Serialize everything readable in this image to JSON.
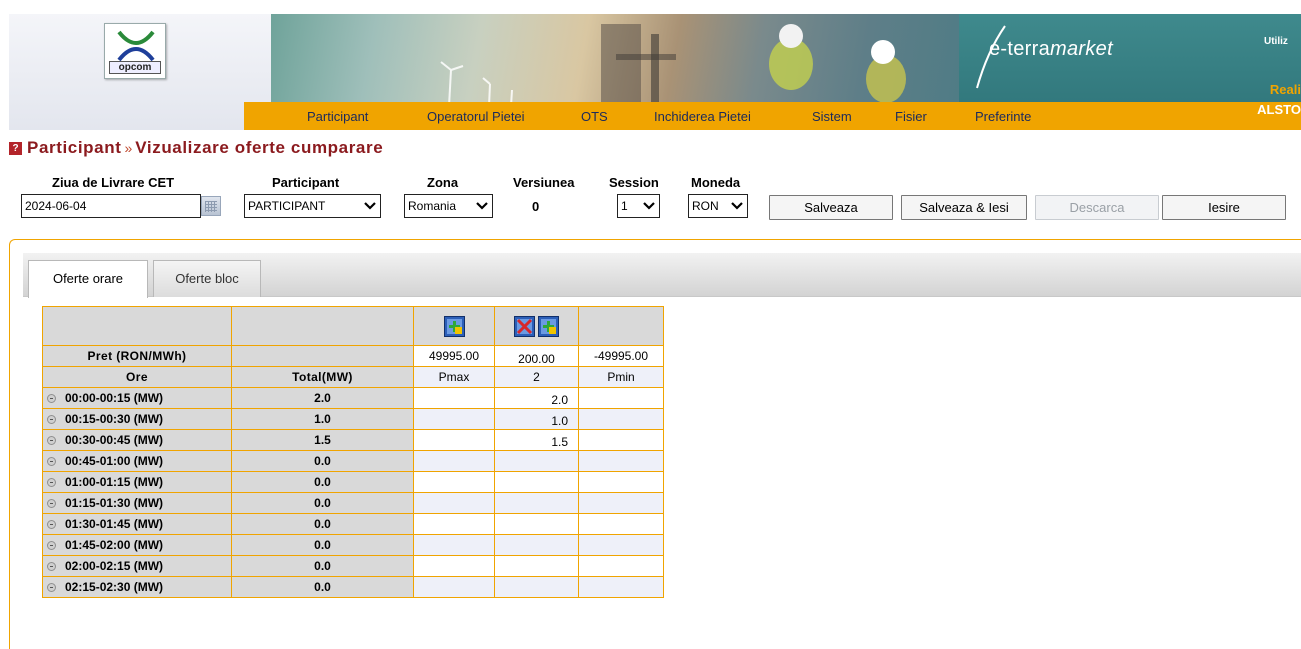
{
  "header": {
    "logo_text": "opcom",
    "brand_prefix": "e-terra",
    "brand_suffix": "market",
    "util_label": "Utiliz",
    "user_line_1": "Reali",
    "user_line_2": "ALSTO",
    "menu": [
      "Participant",
      "Operatorul Pietei",
      "OTS",
      "Inchiderea Pietei",
      "Sistem",
      "Fisier",
      "Preferinte"
    ]
  },
  "title": {
    "section": "Participant",
    "separator": "»",
    "page": "Vizualizare oferte cumparare"
  },
  "filters": {
    "date_label": "Ziua de Livrare CET",
    "date_value": "2024-06-04",
    "participant_label": "Participant",
    "participant_value": "PARTICIPANT",
    "zona_label": "Zona",
    "zona_value": "Romania",
    "versiunea_label": "Versiunea",
    "versiunea_value": "0",
    "session_label": "Session",
    "session_value": "1",
    "moneda_label": "Moneda",
    "moneda_value": "RON"
  },
  "buttons": {
    "save": "Salveaza",
    "save_exit": "Salveaza & Iesi",
    "download": "Descarca",
    "exit": "Iesire"
  },
  "tabs": [
    "Oferte orare",
    "Oferte bloc"
  ],
  "grid": {
    "price_label": "Pret (RON/MWh)",
    "hours_label": "Ore",
    "total_label": "Total(MW)",
    "prices": [
      "49995.00",
      "200.00",
      "-49995.00"
    ],
    "column_labels": [
      "Pmax",
      "2",
      "Pmin"
    ],
    "rows": [
      {
        "interval": "00:00-00:15 (MW)",
        "total": "2.0",
        "values": [
          "",
          "2.0",
          ""
        ]
      },
      {
        "interval": "00:15-00:30 (MW)",
        "total": "1.0",
        "values": [
          "",
          "1.0",
          ""
        ]
      },
      {
        "interval": "00:30-00:45 (MW)",
        "total": "1.5",
        "values": [
          "",
          "1.5",
          ""
        ]
      },
      {
        "interval": "00:45-01:00 (MW)",
        "total": "0.0",
        "values": [
          "",
          "",
          ""
        ]
      },
      {
        "interval": "01:00-01:15 (MW)",
        "total": "0.0",
        "values": [
          "",
          "",
          ""
        ]
      },
      {
        "interval": "01:15-01:30 (MW)",
        "total": "0.0",
        "values": [
          "",
          "",
          ""
        ]
      },
      {
        "interval": "01:30-01:45 (MW)",
        "total": "0.0",
        "values": [
          "",
          "",
          ""
        ]
      },
      {
        "interval": "01:45-02:00 (MW)",
        "total": "0.0",
        "values": [
          "",
          "",
          ""
        ]
      },
      {
        "interval": "02:00-02:15 (MW)",
        "total": "0.0",
        "values": [
          "",
          "",
          ""
        ]
      },
      {
        "interval": "02:15-02:30 (MW)",
        "total": "0.0",
        "values": [
          "",
          "",
          ""
        ]
      }
    ]
  },
  "colors": {
    "accent_orange": "#f0a400",
    "title_red": "#8b1a1e",
    "menu_text": "#1b2a5c",
    "brand_teal": "#2e7378"
  }
}
